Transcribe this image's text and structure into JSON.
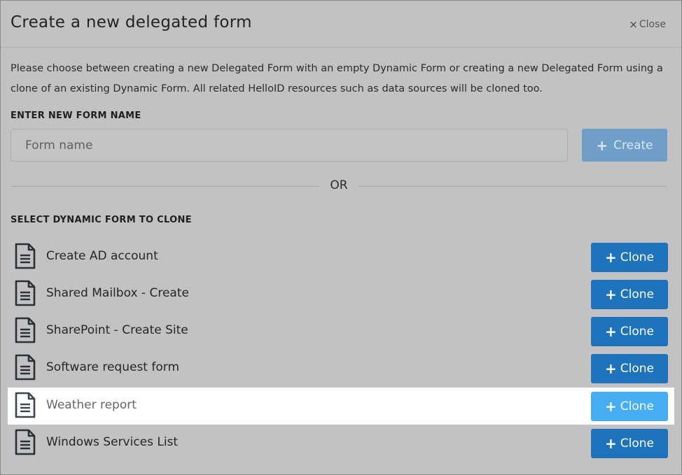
{
  "dialog": {
    "title": "Create a new delegated form",
    "close_label": "Close",
    "close_icon": "×",
    "description": "Please choose between creating a new Delegated Form with an empty Dynamic Form or creating a new Delegated Form using a clone of an existing Dynamic Form. All related HelloID resources such as data sources will be cloned too."
  },
  "new_form": {
    "section_label": "ENTER NEW FORM NAME",
    "input_placeholder": "Form name",
    "input_value": "",
    "create_label": "Create",
    "create_icon": "+"
  },
  "divider": {
    "or_label": "OR"
  },
  "clone": {
    "section_label": "SELECT DYNAMIC FORM TO CLONE",
    "button_label": "Clone",
    "button_icon": "+",
    "items": [
      {
        "label": "Create AD account",
        "highlighted": false
      },
      {
        "label": "Shared Mailbox - Create",
        "highlighted": false
      },
      {
        "label": "SharePoint - Create Site",
        "highlighted": false
      },
      {
        "label": "Software request form",
        "highlighted": false
      },
      {
        "label": "Weather report",
        "highlighted": true
      },
      {
        "label": "Windows Services List",
        "highlighted": false
      }
    ]
  },
  "colors": {
    "primary_button": "#1d74bd",
    "highlight_button": "#45aef2",
    "disabled_button": "#6f9fc8",
    "overlay_bg": "#c2c2c2",
    "highlight_row": "#ffffff"
  },
  "icons": {
    "document": "document-icon",
    "close": "close-icon",
    "plus": "plus-icon"
  }
}
